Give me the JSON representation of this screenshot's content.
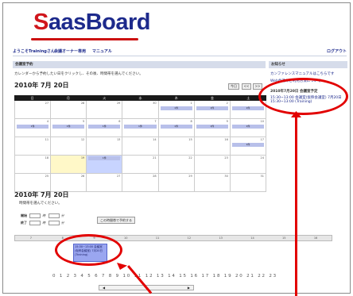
{
  "logo": {
    "first_letter": "S",
    "rest": "aasBoard"
  },
  "nav": {
    "welcome": "ようこそTrainingさん",
    "owner": "会議オーナー専用",
    "manual": "マニュアル",
    "logout": "ログアウト"
  },
  "reservation": {
    "header": "会議室予約",
    "instruction": "カレンダーから予約したい日をクリックし、その後、時間帯を選んでください。",
    "month_title": "2010年 7月 20日",
    "today_btn": "今日",
    "prev_btn": "<<",
    "next_btn": ">>"
  },
  "calendar": {
    "weekdays": [
      "日",
      "月",
      "火",
      "水",
      "木",
      "金",
      "土"
    ],
    "weeks": [
      [
        "27",
        "28",
        "29",
        "30",
        "1",
        "2",
        "3"
      ],
      [
        "4",
        "5",
        "6",
        "7",
        "8",
        "9",
        "10"
      ],
      [
        "11",
        "12",
        "13",
        "14",
        "15",
        "16",
        "17"
      ],
      [
        "18",
        "19",
        "20",
        "21",
        "22",
        "23",
        "24"
      ],
      [
        "25",
        "26",
        "27",
        "28",
        "29",
        "30",
        "31"
      ]
    ],
    "event_label": "1件"
  },
  "side": {
    "header": "お知らせ",
    "line1": "カンファレンスマニュアルはこちらです",
    "line2": "Web会議のご利用方法について",
    "sched_title": "2010年7月20日 会議室予定",
    "sched_entry": "15:30~13:00 会議室(仮称会議室) 7月20日 15:30~13:00 (Training)"
  },
  "detail": {
    "title": "2010年 7月 20日",
    "subtitle": "時間帯を選んでください。",
    "start_label": "開始",
    "end_label": "終了",
    "hour_unit": "時",
    "min_unit": "分",
    "submit": "この時間帯で予約する"
  },
  "timeline": {
    "hours": [
      "7",
      "8",
      "9",
      "10",
      "11",
      "12",
      "13",
      "14",
      "15",
      "16"
    ]
  },
  "slot": {
    "text": "15:30~13:00 会議室(仮称会議室) 7月20日 (Training)"
  },
  "hour_row": "0 1 2 3 4 5 6 7 8 9 10 11 12 13 14 15 16 17 18 19 20 21 22 23",
  "scroll": {
    "left": "◀",
    "right": "▶"
  }
}
